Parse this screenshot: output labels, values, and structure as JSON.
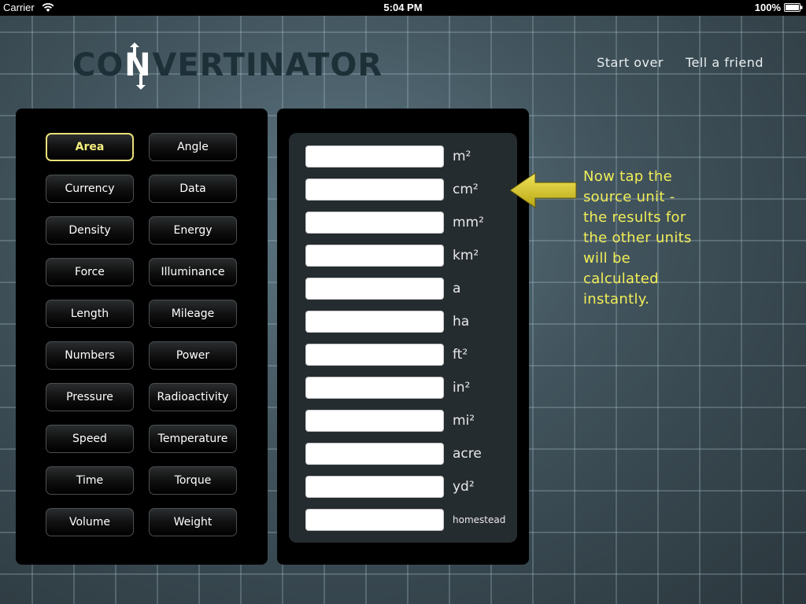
{
  "status_bar": {
    "carrier": "Carrier",
    "time": "5:04 PM",
    "battery": "100%"
  },
  "app": {
    "logo": {
      "pre": "CO",
      "n": "N",
      "post": "VERTINATOR"
    },
    "links": {
      "start_over": "Start over",
      "tell_friend": "Tell a friend"
    }
  },
  "categories": [
    "Area",
    "Angle",
    "Currency",
    "Data",
    "Density",
    "Energy",
    "Force",
    "Illuminance",
    "Length",
    "Mileage",
    "Numbers",
    "Power",
    "Pressure",
    "Radioactivity",
    "Speed",
    "Temperature",
    "Time",
    "Torque",
    "Volume",
    "Weight"
  ],
  "active_category": "Area",
  "units": [
    {
      "label": "m²",
      "value": ""
    },
    {
      "label": "cm²",
      "value": ""
    },
    {
      "label": "mm²",
      "value": ""
    },
    {
      "label": "km²",
      "value": ""
    },
    {
      "label": "a",
      "value": ""
    },
    {
      "label": "ha",
      "value": ""
    },
    {
      "label": "ft²",
      "value": ""
    },
    {
      "label": "in²",
      "value": ""
    },
    {
      "label": "mi²",
      "value": ""
    },
    {
      "label": "acre",
      "value": ""
    },
    {
      "label": "yd²",
      "value": ""
    },
    {
      "label": "homestead",
      "value": ""
    }
  ],
  "hint": {
    "lines": [
      "Now tap the",
      "source unit -",
      "the results for",
      "the other units",
      "will be",
      "calculated",
      "instantly."
    ]
  },
  "colors": {
    "accent": "#f2ee58",
    "active_border": "#e8e07a",
    "arrow": "#d8c82a"
  },
  "icons": {
    "wifi": "wifi-icon",
    "battery": "battery-icon",
    "arrow": "left-arrow-icon",
    "logo_arrows": "up-down-arrows-icon"
  }
}
